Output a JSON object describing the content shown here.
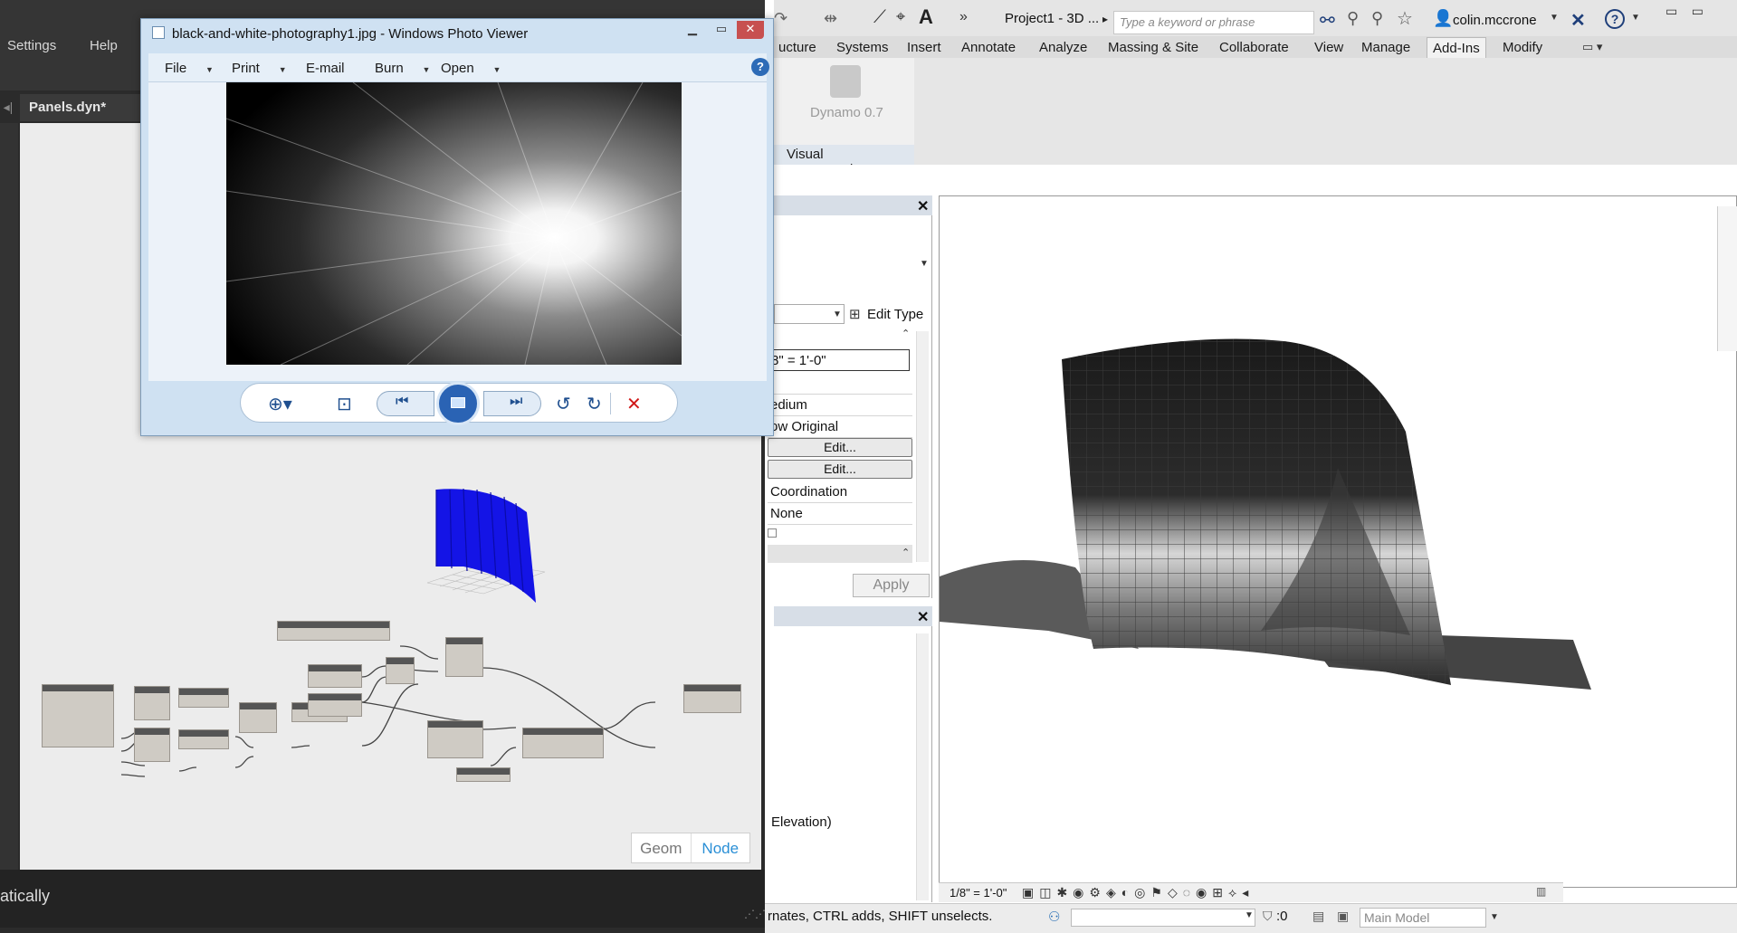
{
  "dynamo": {
    "menu": [
      "Settings",
      "Help"
    ],
    "tab_title": "Panels.dyn*",
    "canvas_toggle": {
      "geom": "Geom",
      "node": "Node"
    },
    "console_text": "atically"
  },
  "photo_viewer": {
    "title": "black-and-white-photography1.jpg - Windows Photo Viewer",
    "menu": [
      {
        "label": "File",
        "caret": true
      },
      {
        "label": "Print",
        "caret": true
      },
      {
        "label": "E-mail",
        "caret": false
      },
      {
        "label": "Burn",
        "caret": true
      },
      {
        "label": "Open",
        "caret": true
      }
    ],
    "help_glyph": "?"
  },
  "revit": {
    "title": "Project1 - 3D ...",
    "search_placeholder": "Type a keyword or phrase",
    "user": "colin.mccrone",
    "tabs": [
      "ucture",
      "Systems",
      "Insert",
      "Annotate",
      "Analyze",
      "Massing & Site",
      "Collaborate",
      "View",
      "Manage",
      "Add-Ins",
      "Modify"
    ],
    "active_tab": "Add-Ins",
    "ribbon_button": "Dynamo 0.7",
    "ribbon_panel": "Visual Programming",
    "properties": {
      "edit_type": "Edit Type",
      "scale": "8\" = 1'-0\"",
      "detail": "edium",
      "parts": "ow Original",
      "edit1": "Edit...",
      "edit2": "Edit...",
      "discipline": "Coordination",
      "none": "None",
      "apply": "Apply"
    },
    "browser_item": "Elevation)",
    "view_scale": "1/8\" = 1'-0\"",
    "status_text": "rnates, CTRL adds, SHIFT unselects.",
    "status_sel_count": ":0",
    "model_select": "Main Model"
  }
}
